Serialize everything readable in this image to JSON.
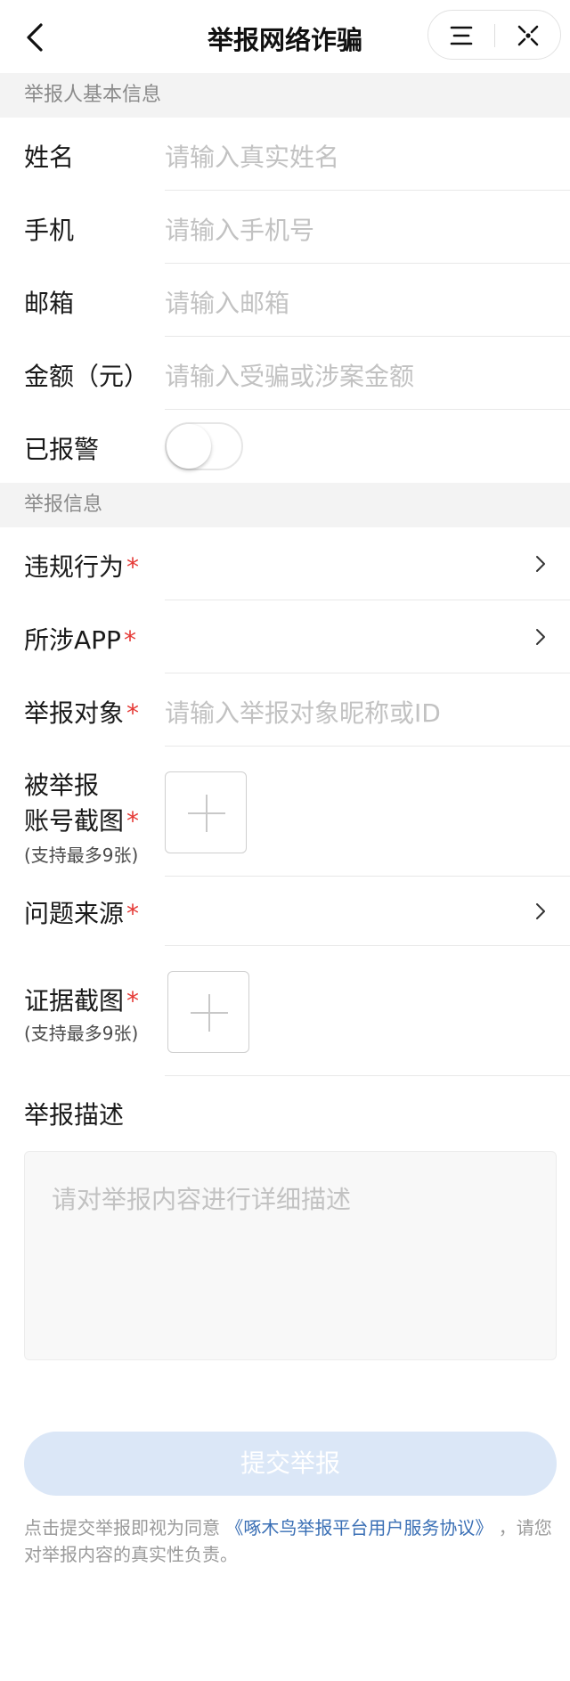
{
  "nav": {
    "title": "举报网络诈骗",
    "icons": {
      "back": "back-arrow-icon",
      "menu": "menu-icon",
      "close": "close-target-icon"
    }
  },
  "sections": {
    "basic_info": "举报人基本信息",
    "report_info": "举报信息"
  },
  "fields": {
    "name": {
      "label": "姓名",
      "placeholder": "请输入真实姓名",
      "value": ""
    },
    "phone": {
      "label": "手机",
      "placeholder": "请输入手机号",
      "value": ""
    },
    "email": {
      "label": "邮箱",
      "placeholder": "请输入邮箱",
      "value": ""
    },
    "amount": {
      "label": "金额（元）",
      "placeholder": "请输入受骗或涉案金额",
      "value": ""
    },
    "reported_police": {
      "label": "已报警",
      "on": false
    },
    "violation": {
      "label": "违规行为",
      "required": "*"
    },
    "app": {
      "label": "所涉APP",
      "required": "*"
    },
    "target": {
      "label": "举报对象",
      "required": "*",
      "placeholder": "请输入举报对象昵称或ID",
      "value": ""
    },
    "account_screenshot": {
      "label_line1": "被举报",
      "label_line2": "账号截图",
      "required": "*",
      "note": "(支持最多9张)"
    },
    "source": {
      "label": "问题来源",
      "required": "*"
    },
    "evidence_screenshot": {
      "label": "证据截图",
      "required": "*",
      "note": "(支持最多9张)"
    },
    "description": {
      "label": "举报描述",
      "placeholder": "请对举报内容进行详细描述",
      "value": ""
    }
  },
  "submit": {
    "label": "提交举报",
    "enabled": false
  },
  "agreement": {
    "prefix": "点击提交举报即视为同意",
    "link": "《啄木鸟举报平台用户服务协议》",
    "suffix": "，请您对举报内容的真实性负责。"
  },
  "colors": {
    "accent_link": "#3a6fb5",
    "required": "#e53935",
    "submit_disabled_bg": "#dbe7f7",
    "section_bg": "#f3f3f3"
  }
}
